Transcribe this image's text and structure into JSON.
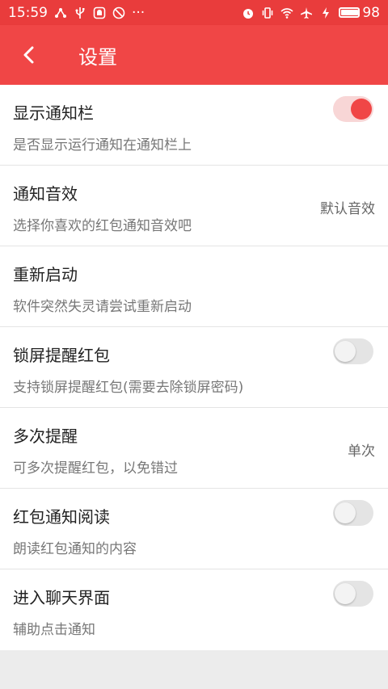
{
  "status_bar": {
    "time": "15:59",
    "more": "···",
    "battery": "98"
  },
  "app_bar": {
    "title": "设置"
  },
  "settings": [
    {
      "title": "显示通知栏",
      "description": "是否显示运行通知在通知栏上",
      "toggle": "on"
    },
    {
      "title": "通知音效",
      "description": "选择你喜欢的红包通知音效吧",
      "value": "默认音效"
    },
    {
      "title": "重新启动",
      "description": "软件突然失灵请尝试重新启动"
    },
    {
      "title": "锁屏提醒红包",
      "description": "支持锁屏提醒红包(需要去除锁屏密码)",
      "toggle": "off"
    },
    {
      "title": "多次提醒",
      "description": "可多次提醒红包，以免错过",
      "value": "单次"
    },
    {
      "title": "红包通知阅读",
      "description": "朗读红包通知的内容",
      "toggle": "off"
    },
    {
      "title": "进入聊天界面",
      "description": "辅助点击通知",
      "toggle": "off"
    }
  ],
  "colors": {
    "status_bar": "#e93c3c",
    "app_bar": "#f04646",
    "accent": "#f04646"
  }
}
